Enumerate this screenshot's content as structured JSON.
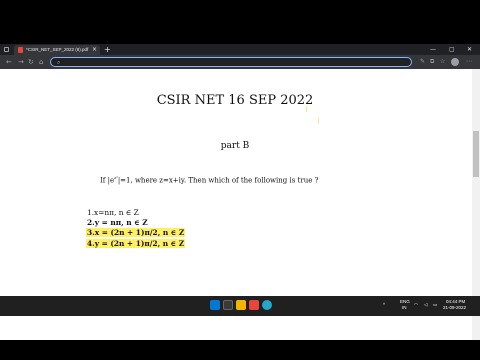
{
  "browser": {
    "tab_title": "*CSIR_NET_SEP_2022 (8).pdf",
    "tab_close": "×",
    "new_tab": "+",
    "window_controls": {
      "minimize": "—",
      "maximize": "▢",
      "close": "✕"
    },
    "nav": {
      "back": "←",
      "forward": "→",
      "refresh": "↻",
      "home": "⌂"
    },
    "omnibox": {
      "value": "",
      "icon": "search-icon"
    }
  },
  "document": {
    "title": "CSIR NET 16 SEP 2022",
    "section": "part B",
    "question_prefix": "If |e",
    "question_sup": "z²",
    "question_rest": "|=1, where z=x+iy. Then which of the following is true ?",
    "options": [
      {
        "label": "1.x=nπ, n ∈ Z",
        "highlighted": false
      },
      {
        "label": "2.y = nπ, n ∈ Z",
        "highlighted": false
      },
      {
        "label": "3.x = (2n + 1)π/2, n ∈ Z",
        "highlighted": true
      },
      {
        "label": "4.y = (2n + 1)π/2, n ∈ Z",
        "highlighted": true
      }
    ],
    "highlight_color": "#ffef62"
  },
  "taskbar": {
    "lang": "ENG",
    "region": "IN",
    "time": "04:44 PM",
    "date": "21-09-2022"
  }
}
